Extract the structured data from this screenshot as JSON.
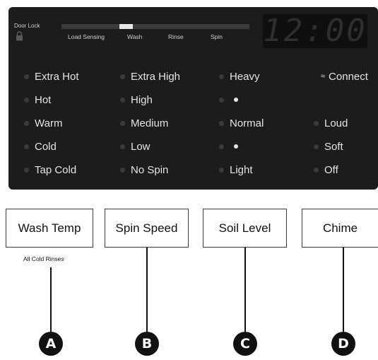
{
  "status": {
    "door_lock_label": "Door Lock",
    "cycle_progress": [
      "Load Sensing",
      "Wash",
      "Rinse",
      "Spin"
    ],
    "active_stage": "Wash",
    "clock": "12:00"
  },
  "wash_temp": {
    "options": [
      "Extra Hot",
      "Hot",
      "Warm",
      "Cold",
      "Tap Cold"
    ]
  },
  "spin_speed": {
    "options": [
      "Extra High",
      "High",
      "Medium",
      "Low",
      "No Spin"
    ]
  },
  "soil_level": {
    "options": [
      "Heavy",
      "Normal",
      "Light"
    ]
  },
  "chime": {
    "connect_label": "Connect",
    "options": [
      "Loud",
      "Soft",
      "Off"
    ]
  },
  "buttons": {
    "wash_temp": "Wash Temp",
    "spin_speed": "Spin Speed",
    "soil_level": "Soil Level",
    "chime": "Chime",
    "all_cold_rinses": "All Cold Rinses"
  },
  "callouts": [
    "A",
    "B",
    "C",
    "D"
  ],
  "colors": {
    "panel_bg": "#1c1c1c",
    "indicator_off": "#3a3a3a",
    "text_light": "#e4e4e4"
  }
}
